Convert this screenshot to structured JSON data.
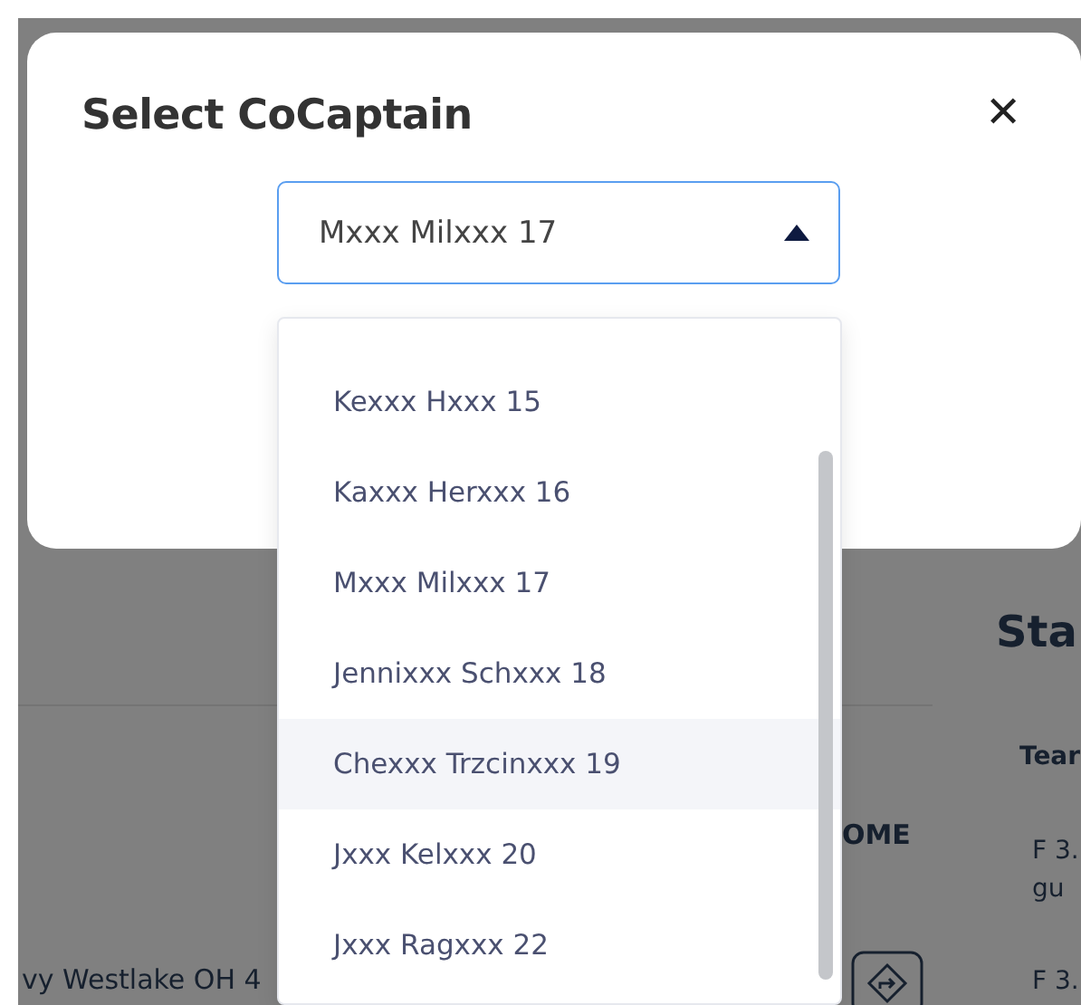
{
  "background_page": {
    "heading": "Sta",
    "section_label": "Tear",
    "column_label": "OME",
    "address": "vy Westlake OH 4",
    "entries": [
      "F 3.",
      "gu",
      "F 3."
    ]
  },
  "dialog": {
    "title": "Select CoCaptain",
    "close": "✕",
    "select": {
      "value": "Mxxx Milxxx 17",
      "expanded": true,
      "options": [
        {
          "label": "Kexxx Hxxx 15",
          "hovered": false
        },
        {
          "label": "Kaxxx Herxxx 16",
          "hovered": false
        },
        {
          "label": "Mxxx Milxxx 17",
          "hovered": false
        },
        {
          "label": "Jennixxx Schxxx 18",
          "hovered": false
        },
        {
          "label": "Chexxx Trzcinxxx 19",
          "hovered": true
        },
        {
          "label": "Jxxx Kelxxx 20",
          "hovered": false
        },
        {
          "label": "Jxxx Ragxxx 22",
          "hovered": false
        }
      ]
    }
  }
}
